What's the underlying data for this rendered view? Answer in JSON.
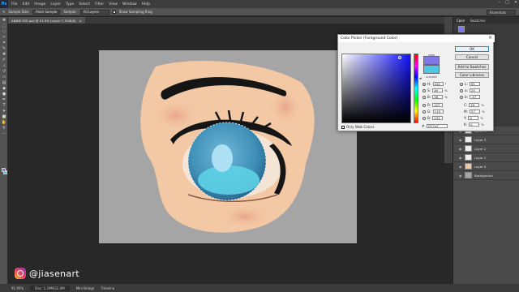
{
  "app": {
    "logo": "Ps",
    "menus": [
      "File",
      "Edit",
      "Image",
      "Layer",
      "Type",
      "Select",
      "Filter",
      "View",
      "Window",
      "Help"
    ],
    "window_controls": [
      "–",
      "□",
      "✕"
    ]
  },
  "options_bar": {
    "sample_size_label": "Sample Size:",
    "sample_size_value": "Point Sample",
    "sample_label": "Sample:",
    "sample_value": "All Layers",
    "show_ring_label": "Show Sampling Ring",
    "workspace": "Essentials"
  },
  "document": {
    "tab_title": "ANIME EYE.psd @ 91.9% (Layer 7, RGB/8)",
    "tab_close": "×"
  },
  "status_bar": {
    "zoom": "91.95%",
    "doc_info": "Doc: 1.29M/22.0M",
    "tabs": [
      "Mini Bridge",
      "Timeline"
    ]
  },
  "color_panel": {
    "tabs": [
      "Color",
      "Swatches"
    ]
  },
  "layers": [
    {
      "name": "Layer 4",
      "selected": false
    },
    {
      "name": "Layer 3",
      "selected": false
    },
    {
      "name": "Layer 2",
      "selected": false
    },
    {
      "name": "Layer 1",
      "selected": false
    },
    {
      "name": "Layer 5",
      "selected": false
    },
    {
      "name": "Background",
      "selected": false
    }
  ],
  "color_picker": {
    "title": "Color Picker (Foreground Color)",
    "new_label": "new",
    "current_label": "current",
    "buttons": {
      "ok": "OK",
      "cancel": "Cancel",
      "add_to_swatches": "Add to Swatches",
      "color_libraries": "Color Libraries"
    },
    "fields": {
      "H": {
        "value": "244",
        "unit": "°"
      },
      "S": {
        "value": "49",
        "unit": "%"
      },
      "B": {
        "value": "96",
        "unit": "%"
      },
      "R": {
        "value": "127",
        "unit": ""
      },
      "G": {
        "value": "119",
        "unit": ""
      },
      "B2": {
        "value": "231",
        "unit": ""
      },
      "L": {
        "value": "55",
        "unit": ""
      },
      "a": {
        "value": "25",
        "unit": ""
      },
      "b": {
        "value": "-57",
        "unit": ""
      },
      "C": {
        "value": "59",
        "unit": "%"
      },
      "M": {
        "value": "57",
        "unit": "%"
      },
      "Y": {
        "value": "0",
        "unit": "%"
      },
      "K": {
        "value": "0",
        "unit": "%"
      }
    },
    "only_web_colors": "Only Web Colors",
    "hex": "7f77e7",
    "new_color": "#7f77e7",
    "current_color": "#50c7e0"
  },
  "watermark": {
    "icon": "instagram-icon",
    "handle": "@jiasenart"
  }
}
